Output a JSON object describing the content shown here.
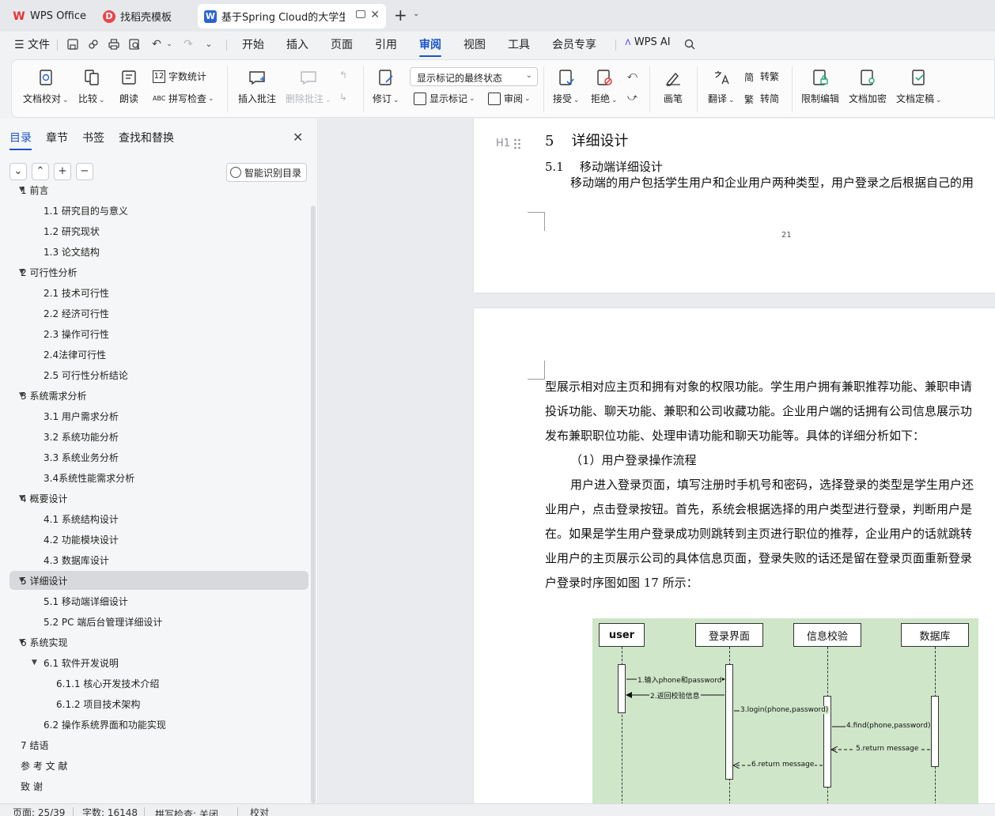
{
  "tabs": [
    {
      "label": "WPS Office",
      "icon": "wps-logo-icon",
      "color": "#e8312f"
    },
    {
      "label": "找稻壳模板",
      "icon": "daoke-logo-icon",
      "color": "#e8464a"
    },
    {
      "label": "基于Spring Cloud的大学生兼",
      "icon": "word-doc-icon",
      "color": "#2c63d6"
    }
  ],
  "menu": {
    "file": "文件",
    "items": [
      "开始",
      "插入",
      "页面",
      "引用",
      "审阅",
      "视图",
      "工具",
      "会员专享"
    ],
    "active": "审阅",
    "wps_ai": "WPS AI"
  },
  "ribbon": {
    "doc_check": "文档校对",
    "compare": "比较",
    "read_aloud": "朗读",
    "word_count": "字数统计",
    "spell_check": "拼写检查",
    "insert_comment": "插入批注",
    "delete_comment": "删除批注",
    "revise": "修订",
    "markup_state": "显示标记的最终状态",
    "show_markup": "显示标记",
    "review": "审阅",
    "accept": "接受",
    "reject": "拒绝",
    "brush": "画笔",
    "translate": "翻译",
    "to_traditional": "转繁",
    "to_simplified": "转简",
    "restrict_edit": "限制编辑",
    "encrypt": "文档加密",
    "finalize": "文档定稿"
  },
  "nav": {
    "tabs": [
      "目录",
      "章节",
      "书签",
      "查找和替换"
    ],
    "active": "目录",
    "smart_button": "智能识别目录",
    "toc": [
      {
        "label": "1  前言",
        "level": 0,
        "expanded": true
      },
      {
        "label": "1.1  研究目的与意义",
        "level": 1
      },
      {
        "label": "1.2  研究现状",
        "level": 1
      },
      {
        "label": "1.3  论文结构",
        "level": 1
      },
      {
        "label": "2  可行性分析",
        "level": 0,
        "expanded": true
      },
      {
        "label": "2.1  技术可行性",
        "level": 1
      },
      {
        "label": "2.2  经济可行性",
        "level": 1
      },
      {
        "label": "2.3  操作可行性",
        "level": 1
      },
      {
        "label": "2.4法律可行性",
        "level": 1
      },
      {
        "label": "2.5  可行性分析结论",
        "level": 1
      },
      {
        "label": "3  系统需求分析",
        "level": 0,
        "expanded": true
      },
      {
        "label": "3.1  用户需求分析",
        "level": 1
      },
      {
        "label": "3.2  系统功能分析",
        "level": 1
      },
      {
        "label": "3.3  系统业务分析",
        "level": 1
      },
      {
        "label": "3.4系统性能需求分析",
        "level": 1
      },
      {
        "label": "4  概要设计",
        "level": 0,
        "expanded": true
      },
      {
        "label": "4.1  系统结构设计",
        "level": 1
      },
      {
        "label": "4.2  功能模块设计",
        "level": 1
      },
      {
        "label": "4.3  数据库设计",
        "level": 1
      },
      {
        "label": "5  详细设计",
        "level": 0,
        "expanded": true,
        "selected": true
      },
      {
        "label": "5.1  移动端详细设计",
        "level": 1
      },
      {
        "label": "5.2  PC 端后台管理详细设计",
        "level": 1
      },
      {
        "label": "6  系统实现",
        "level": 0,
        "expanded": true
      },
      {
        "label": "6.1  软件开发说明",
        "level": 1,
        "expanded": true
      },
      {
        "label": "6.1.1  核心开发技术介绍",
        "level": 2
      },
      {
        "label": "6.1.2  项目技术架构",
        "level": 2
      },
      {
        "label": "6.2  操作系统界面和功能实现",
        "level": 1
      },
      {
        "label": "7  结语",
        "level": 0
      },
      {
        "label": "参  考  文  献",
        "level": 0
      },
      {
        "label": "致        谢",
        "level": 0
      }
    ]
  },
  "document": {
    "heading_marker": "H1",
    "h1_num": "5",
    "h1_text": "详细设计",
    "h2_num": "5.1",
    "h2_text": "移动端详细设计",
    "para1": "移动端的用户包括学生用户和企业用户两种类型，用户登录之后根据自己的用",
    "page_number": "21",
    "lines": [
      "型展示相对应主页和拥有对象的权限功能。学生用户拥有兼职推荐功能、兼职申请",
      "投诉功能、聊天功能、兼职和公司收藏功能。企业用户端的话拥有公司信息展示功",
      "发布兼职职位功能、处理申请功能和聊天功能等。具体的详细分析如下：",
      "（1）用户登录操作流程",
      "用户进入登录页面，填写注册时手机号和密码，选择登录的类型是学生用户还",
      "业用户，点击登录按钮。首先，系统会根据选择的用户类型进行登录，判断用户是",
      "在。如果是学生用户登录成功则跳转到主页进行职位的推荐，企业用户的话就跳转",
      "业用户的主页展示公司的具体信息页面，登录失败的话还是留在登录页面重新登录",
      "户登录时序图如图 17 所示："
    ],
    "diagram": {
      "actors": [
        "user",
        "登录界面",
        "信息校验",
        "数据库"
      ],
      "messages": [
        "1.输入phone和password",
        "2.返回校验信息",
        "3.login(phone,password)",
        "4.find(phone,password)",
        "5.return message",
        "6.return message"
      ]
    }
  },
  "status": {
    "page": "页面: 25/39",
    "words": "字数: 16148",
    "spell": "拼写检查: 关闭",
    "proof": "校对"
  }
}
